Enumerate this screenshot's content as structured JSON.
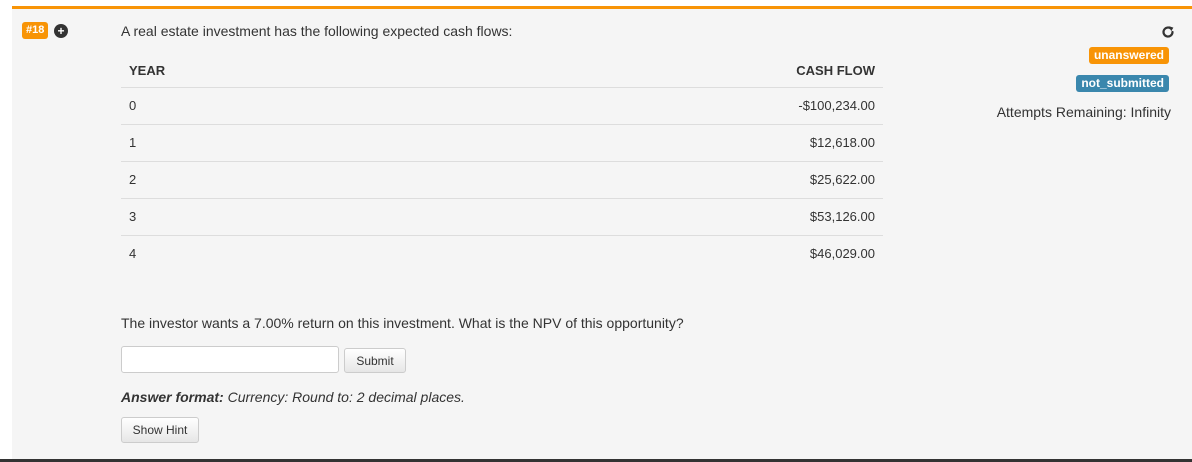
{
  "question": {
    "number": "#18",
    "prompt": "A real estate investment has the following expected cash flows:",
    "table": {
      "headers": [
        "YEAR",
        "CASH FLOW"
      ],
      "rows": [
        [
          "0",
          "-$100,234.00"
        ],
        [
          "1",
          "$12,618.00"
        ],
        [
          "2",
          "$25,622.00"
        ],
        [
          "3",
          "$53,126.00"
        ],
        [
          "4",
          "$46,029.00"
        ]
      ]
    },
    "text": "The investor wants a 7.00% return on this investment. What is the NPV of this opportunity?",
    "answer": {
      "value": "",
      "placeholder": ""
    },
    "submit_label": "Submit",
    "format_label": "Answer format:",
    "format_value": "Currency: Round to: 2 decimal places.",
    "hint_label": "Show Hint"
  },
  "status": {
    "answer_state": "unanswered",
    "submit_state": "not_submitted",
    "attempts": "Attempts Remaining: Infinity"
  },
  "icons": {
    "expand": "plus-circle-icon",
    "refresh": "refresh-icon"
  },
  "colors": {
    "accent_orange": "#f89406",
    "info_blue": "#3a87ad",
    "panel_bg": "#f5f5f5"
  }
}
